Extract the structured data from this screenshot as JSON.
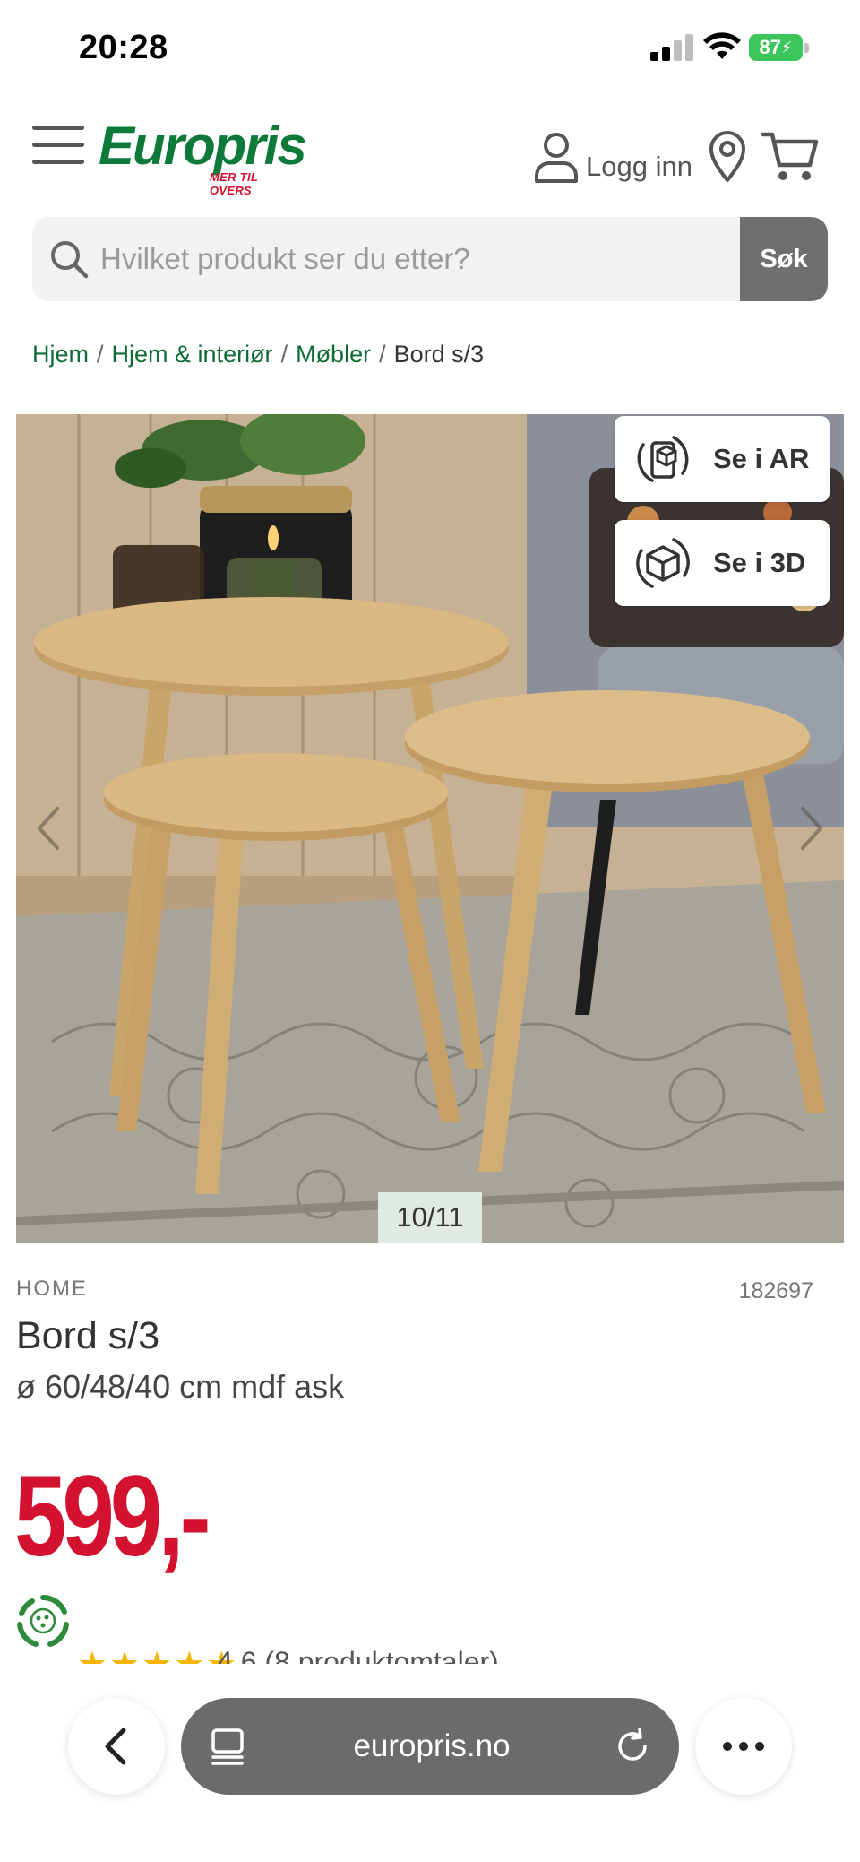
{
  "status_bar": {
    "time": "20:28",
    "battery": "87",
    "battery_color": "#3cc55b"
  },
  "header": {
    "logo_text": "Europris",
    "logo_tagline": "MER TIL OVERS",
    "brand_green": "#0d7a3a",
    "brand_red": "#d3122f",
    "login_label": "Logg inn",
    "icons": [
      "menu-icon",
      "user-icon",
      "location-pin-icon",
      "cart-icon"
    ]
  },
  "search": {
    "placeholder": "Hvilket produkt ser du etter?",
    "value": "",
    "button_label": "Søk"
  },
  "breadcrumb": {
    "items": [
      {
        "label": "Hjem",
        "link": true
      },
      {
        "label": "Hjem & interiør",
        "link": true
      },
      {
        "label": "Møbler",
        "link": true
      },
      {
        "label": "Bord s/3",
        "link": false
      }
    ],
    "separator": "/"
  },
  "gallery": {
    "ar_label": "Se i AR",
    "threed_label": "Se i 3D",
    "counter": "10/11"
  },
  "product": {
    "brand": "HOME",
    "sku": "182697",
    "title": "Bord s/3",
    "subtitle": "ø 60/48/40 cm mdf ask",
    "price": "599,-",
    "rating_value": 4.6,
    "rating_text": "4,6  (8 produktomtaler)"
  },
  "browser": {
    "url": "europris.no"
  }
}
